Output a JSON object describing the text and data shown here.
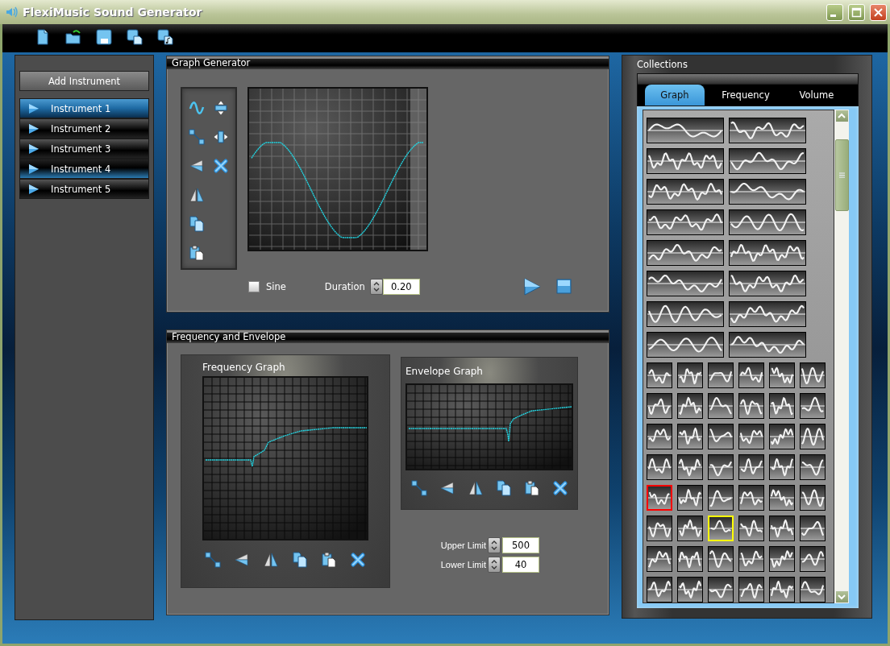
{
  "window": {
    "title": "FlexiMusic Sound Generator"
  },
  "add_instrument": {
    "label": "Add Instrument"
  },
  "instruments": [
    {
      "name": "Instrument 1",
      "selected": true,
      "highlighted": false
    },
    {
      "name": "Instrument 2",
      "selected": false,
      "highlighted": false
    },
    {
      "name": "Instrument 3",
      "selected": false,
      "highlighted": false
    },
    {
      "name": "Instrument 4",
      "selected": false,
      "highlighted": true
    },
    {
      "name": "Instrument 5",
      "selected": false,
      "highlighted": false
    }
  ],
  "graph_generator": {
    "title": "Graph Generator",
    "sine": {
      "label": "Sine",
      "checked": false
    },
    "duration": {
      "label": "Duration",
      "value": "0.20"
    }
  },
  "frequency_and_envelope": {
    "title": "Frequency and Envelope",
    "frequency_graph": {
      "title": "Frequency Graph"
    },
    "envelope_graph": {
      "title": "Envelope Graph"
    },
    "upper_limit": {
      "label": "Upper Limit",
      "value": "500"
    },
    "lower_limit": {
      "label": "Lower Limit",
      "value": "40"
    }
  },
  "collections": {
    "title": "Collections",
    "tabs": [
      {
        "label": "Graph",
        "selected": true
      },
      {
        "label": "Frequency",
        "selected": false
      },
      {
        "label": "Volume",
        "selected": false
      }
    ],
    "thumbnails": [
      {
        "kind": "wide",
        "selected": false,
        "highlighted": false
      },
      {
        "kind": "wide",
        "selected": false,
        "highlighted": false
      },
      {
        "kind": "wide",
        "selected": false,
        "highlighted": false
      },
      {
        "kind": "wide",
        "selected": false,
        "highlighted": false
      },
      {
        "kind": "wide",
        "selected": false,
        "highlighted": false
      },
      {
        "kind": "wide",
        "selected": false,
        "highlighted": false
      },
      {
        "kind": "wide",
        "selected": false,
        "highlighted": false
      },
      {
        "kind": "wide",
        "selected": false,
        "highlighted": false
      },
      {
        "kind": "wide",
        "selected": false,
        "highlighted": false
      },
      {
        "kind": "wide",
        "selected": false,
        "highlighted": false
      },
      {
        "kind": "wide",
        "selected": false,
        "highlighted": false
      },
      {
        "kind": "wide",
        "selected": false,
        "highlighted": false
      },
      {
        "kind": "wide",
        "selected": false,
        "highlighted": false
      },
      {
        "kind": "wide",
        "selected": false,
        "highlighted": false
      },
      {
        "kind": "wide",
        "selected": false,
        "highlighted": false
      },
      {
        "kind": "wide",
        "selected": false,
        "highlighted": false
      },
      {
        "kind": "small",
        "selected": false,
        "highlighted": false
      },
      {
        "kind": "small",
        "selected": false,
        "highlighted": false
      },
      {
        "kind": "small",
        "selected": false,
        "highlighted": false
      },
      {
        "kind": "small",
        "selected": false,
        "highlighted": false
      },
      {
        "kind": "small",
        "selected": false,
        "highlighted": false
      },
      {
        "kind": "small",
        "selected": false,
        "highlighted": false
      },
      {
        "kind": "small",
        "selected": false,
        "highlighted": false
      },
      {
        "kind": "small",
        "selected": false,
        "highlighted": false
      },
      {
        "kind": "small",
        "selected": false,
        "highlighted": false
      },
      {
        "kind": "small",
        "selected": false,
        "highlighted": false
      },
      {
        "kind": "small",
        "selected": false,
        "highlighted": false
      },
      {
        "kind": "small",
        "selected": false,
        "highlighted": false
      },
      {
        "kind": "small",
        "selected": false,
        "highlighted": false
      },
      {
        "kind": "small",
        "selected": false,
        "highlighted": false
      },
      {
        "kind": "small",
        "selected": false,
        "highlighted": false
      },
      {
        "kind": "small",
        "selected": false,
        "highlighted": false
      },
      {
        "kind": "small",
        "selected": false,
        "highlighted": false
      },
      {
        "kind": "small",
        "selected": false,
        "highlighted": false
      },
      {
        "kind": "small",
        "selected": false,
        "highlighted": false
      },
      {
        "kind": "small",
        "selected": false,
        "highlighted": false
      },
      {
        "kind": "small",
        "selected": false,
        "highlighted": false
      },
      {
        "kind": "small",
        "selected": false,
        "highlighted": false
      },
      {
        "kind": "small",
        "selected": false,
        "highlighted": false
      },
      {
        "kind": "small",
        "selected": false,
        "highlighted": false
      },
      {
        "kind": "small",
        "selected": true,
        "highlighted": false
      },
      {
        "kind": "small",
        "selected": false,
        "highlighted": false
      },
      {
        "kind": "small",
        "selected": false,
        "highlighted": false
      },
      {
        "kind": "small",
        "selected": false,
        "highlighted": false
      },
      {
        "kind": "small",
        "selected": false,
        "highlighted": false
      },
      {
        "kind": "small",
        "selected": false,
        "highlighted": false
      },
      {
        "kind": "small",
        "selected": false,
        "highlighted": false
      },
      {
        "kind": "small",
        "selected": false,
        "highlighted": false
      },
      {
        "kind": "small",
        "selected": false,
        "highlighted": true
      },
      {
        "kind": "small",
        "selected": false,
        "highlighted": false
      },
      {
        "kind": "small",
        "selected": false,
        "highlighted": false
      },
      {
        "kind": "small",
        "selected": false,
        "highlighted": false
      },
      {
        "kind": "small",
        "selected": false,
        "highlighted": false
      },
      {
        "kind": "small",
        "selected": false,
        "highlighted": false
      },
      {
        "kind": "small",
        "selected": false,
        "highlighted": false
      },
      {
        "kind": "small",
        "selected": false,
        "highlighted": false
      },
      {
        "kind": "small",
        "selected": false,
        "highlighted": false
      },
      {
        "kind": "small",
        "selected": false,
        "highlighted": false
      },
      {
        "kind": "small",
        "selected": false,
        "highlighted": false
      },
      {
        "kind": "small",
        "selected": false,
        "highlighted": false
      },
      {
        "kind": "small",
        "selected": false,
        "highlighted": false
      },
      {
        "kind": "small",
        "selected": false,
        "highlighted": false
      },
      {
        "kind": "small",
        "selected": false,
        "highlighted": false
      },
      {
        "kind": "small",
        "selected": false,
        "highlighted": false
      }
    ]
  }
}
